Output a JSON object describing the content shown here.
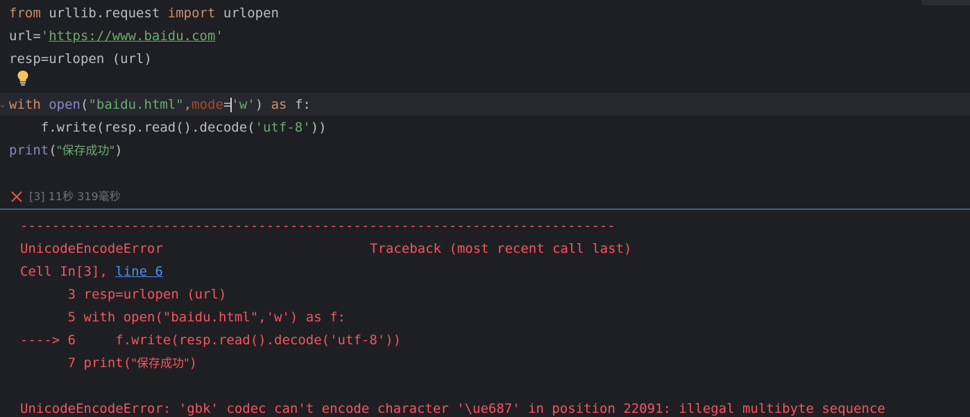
{
  "editor": {
    "line1": {
      "kw_from": "from",
      "mod": " urllib.request ",
      "kw_import": "import",
      "name": " urlopen"
    },
    "line2": {
      "lhs": "url=",
      "q1": "'",
      "url": "https://www.baidu.com",
      "q2": "'"
    },
    "line3": {
      "text": "resp=urlopen (url)"
    },
    "line5": {
      "kw_with": "with",
      "sp": " ",
      "fn_open": "open",
      "p1": "(",
      "s1": "\"baidu.html\"",
      "comma": ",",
      "param": "mode",
      "eq": "=",
      "s2": "'w'",
      "p2": ") ",
      "kw_as": "as",
      "tail": " f:"
    },
    "line6": {
      "pre": "    f.write(resp.read().decode(",
      "s": "'utf-8'",
      "post": "))"
    },
    "line7": {
      "fn_print": "print",
      "p1": "(",
      "s": "\"保存成功\"",
      "p2": ")"
    }
  },
  "cell_status": {
    "icon": "close-icon",
    "text": "[3] 11秒 319毫秒"
  },
  "output": {
    "dashes": "---------------------------------------------------------------------------",
    "error_name": "UnicodeEncodeError",
    "traceback_label": "Traceback (most recent call last)",
    "cell_prefix": "Cell In[3], ",
    "cell_link": "line 6",
    "tb3": "      3 resp=urlopen (url)",
    "tb5": "      5 with open(\"baidu.html\",'w') as f:",
    "tb6": "----> 6     f.write(resp.read().decode('utf-8'))",
    "tb7_pre": "      7 print(",
    "tb7_str": "\"保存成功\"",
    "tb7_post": ")",
    "message": "UnicodeEncodeError: 'gbk' codec can't encode character '\\ue687' in position 22091: illegal multibyte sequence"
  },
  "colors": {
    "background": "#1e1f22",
    "keyword": "#cf8e6d",
    "string": "#6aab73",
    "builtin": "#8888c6",
    "error": "#f75464",
    "link": "#548af7",
    "divider": "#3d6185"
  },
  "icons": {
    "bulb": "lightbulb-icon"
  }
}
